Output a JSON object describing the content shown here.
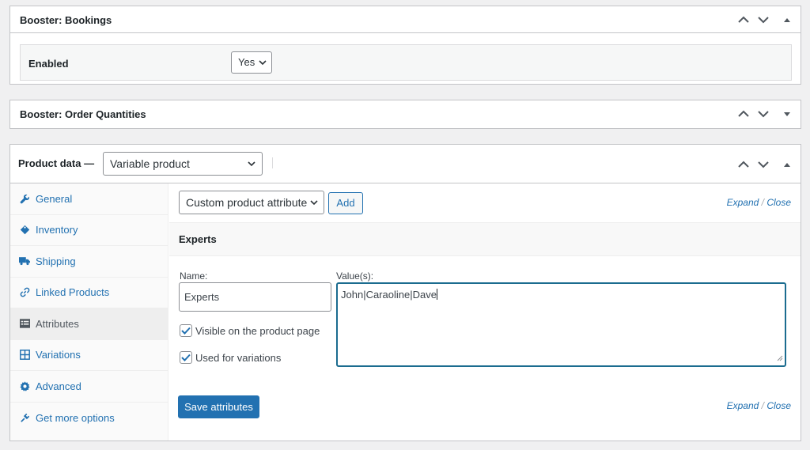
{
  "bookings": {
    "title": "Booster: Bookings",
    "enabled_label": "Enabled",
    "enabled_value": "Yes"
  },
  "order_quantities": {
    "title": "Booster: Order Quantities"
  },
  "product_data": {
    "title": "Product data —",
    "product_type": "Variable product",
    "tabs": [
      {
        "label": "General",
        "icon": "wrench-icon"
      },
      {
        "label": "Inventory",
        "icon": "tag-icon"
      },
      {
        "label": "Shipping",
        "icon": "truck-icon"
      },
      {
        "label": "Linked Products",
        "icon": "link-icon"
      },
      {
        "label": "Attributes",
        "icon": "list-icon",
        "active": true
      },
      {
        "label": "Variations",
        "icon": "grid-icon"
      },
      {
        "label": "Advanced",
        "icon": "gear-icon"
      },
      {
        "label": "Get more options",
        "icon": "plugin-icon"
      }
    ],
    "attributes": {
      "attribute_select": "Custom product attribute",
      "add_label": "Add",
      "expand_label": "Expand",
      "separator": "/",
      "close_label": "Close",
      "attribute_name": "Experts",
      "name_label": "Name:",
      "name_value": "Experts",
      "values_label": "Value(s):",
      "values_value": "John|Caraoline|Dave",
      "visible_label": "Visible on the product page",
      "visible_checked": true,
      "variations_label": "Used for variations",
      "variations_checked": true,
      "save_label": "Save attributes"
    }
  },
  "colors": {
    "link": "#2271b1",
    "primary_button": "#2271b1",
    "focus_border": "#1b6c8f"
  }
}
